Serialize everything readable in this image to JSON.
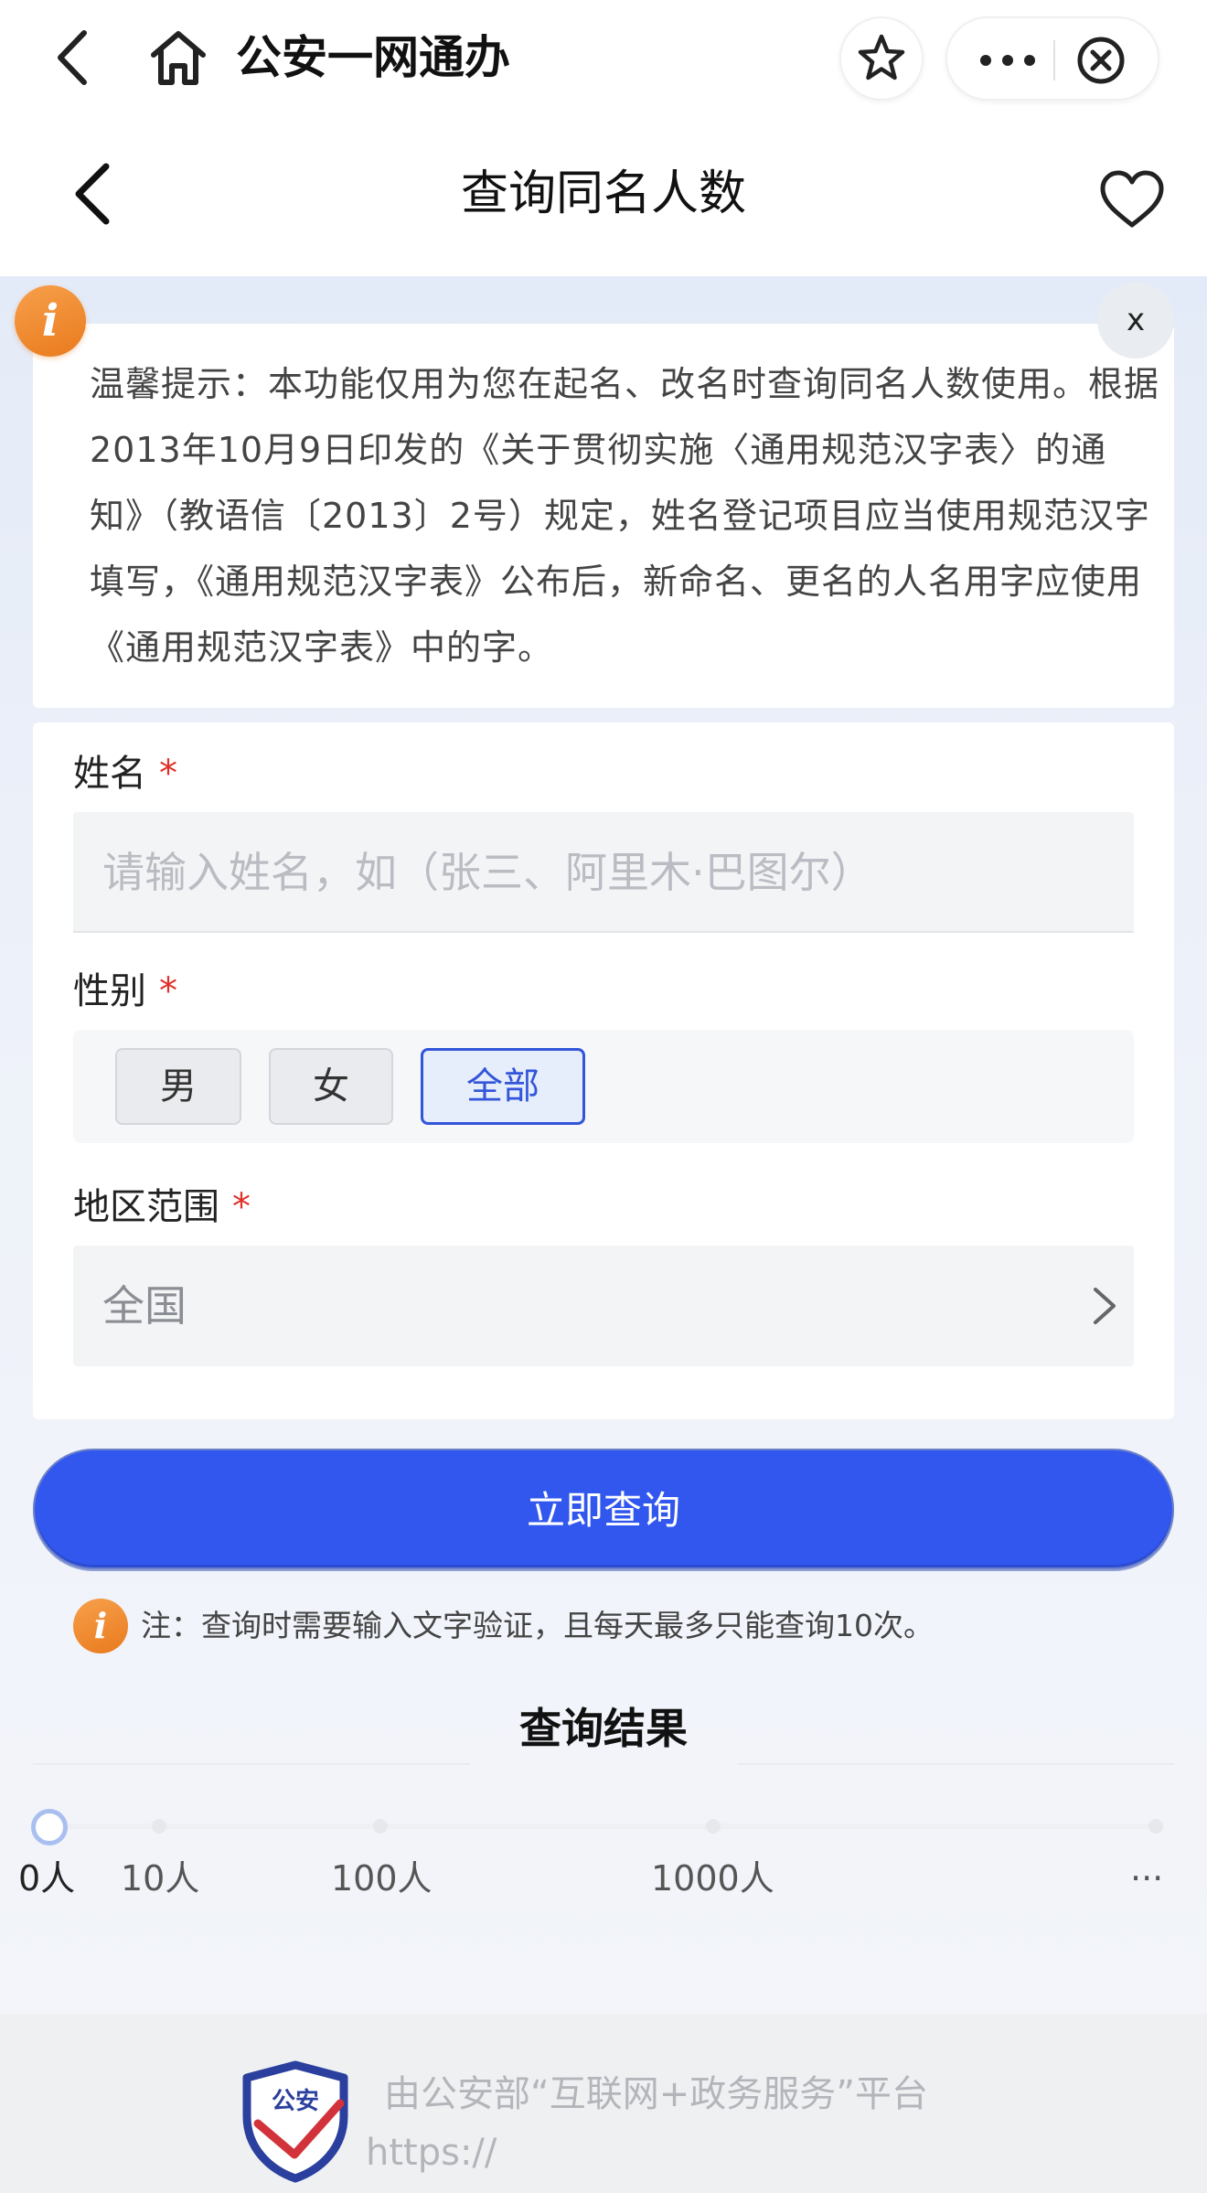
{
  "appbar": {
    "title": "公安一网通办",
    "icons": [
      "back-icon",
      "home-icon",
      "star-icon",
      "more-icon",
      "close-circle-icon"
    ]
  },
  "page": {
    "title": "查询同名人数",
    "icons": [
      "back-icon",
      "heart-icon"
    ]
  },
  "notice": {
    "info_glyph": "i",
    "close_label": "x",
    "text": "温馨提示：本功能仅用为您在起名、改名时查询同名人数使用。根据2013年10月9日印发的《关于贯彻实施〈通用规范汉字表〉的通知》（教语信〔2013〕2号）规定，姓名登记项目应当使用规范汉字填写，《通用规范汉字表》公布后，新命名、更名的人名用字应使用《通用规范汉字表》中的字。"
  },
  "form": {
    "required_mark": "*",
    "name": {
      "label": "姓名",
      "value": "",
      "placeholder": "请输入姓名，如（张三、阿里木·巴图尔）"
    },
    "gender": {
      "label": "性别",
      "options": [
        "男",
        "女",
        "全部"
      ],
      "selected": "全部"
    },
    "region": {
      "label": "地区范围",
      "value": "全国"
    }
  },
  "submit_label": "立即查询",
  "note": {
    "info_glyph": "i",
    "text": "注：查询时需要输入文字验证，且每天最多只能查询10次。"
  },
  "results": {
    "title": "查询结果",
    "scale": [
      "0人",
      "10人",
      "100人",
      "1000人",
      "···"
    ],
    "current_index": 0
  },
  "footer": {
    "badge_text": "公安",
    "line1": "由公安部“互联网+政务服务”平台",
    "line2": "https://"
  },
  "colors": {
    "primary": "#3257ee",
    "required": "#e0302a",
    "info_orange": "#ea7a1d",
    "background": "#e4ebf8"
  }
}
